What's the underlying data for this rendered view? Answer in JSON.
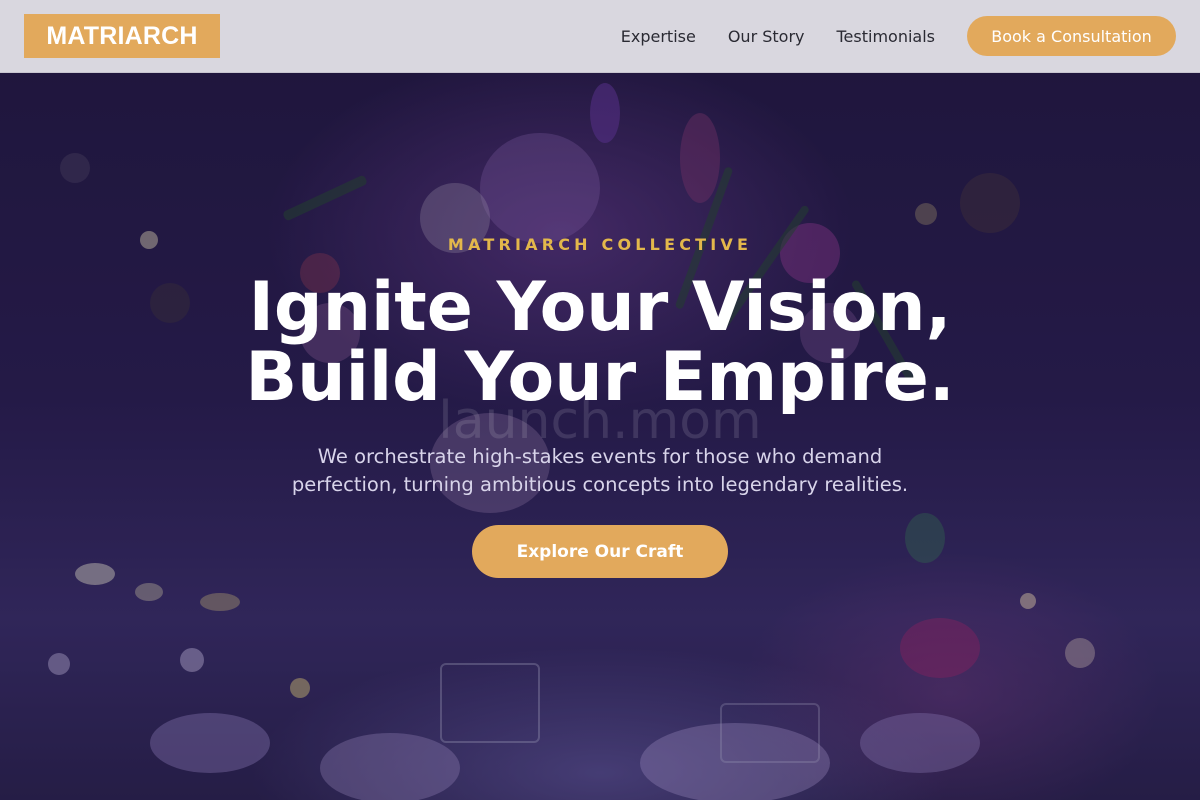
{
  "header": {
    "logo": "MATRIARCH",
    "nav": [
      {
        "label": "Expertise"
      },
      {
        "label": "Our Story"
      },
      {
        "label": "Testimonials"
      }
    ],
    "cta_label": "Book a Consultation"
  },
  "hero": {
    "eyebrow": "MATRIARCH COLLECTIVE",
    "headline_line1": "Ignite Your Vision,",
    "headline_line2": "Build Your Empire.",
    "subtitle": "We orchestrate high-stakes events for those who demand perfection, turning ambitious concepts into legendary realities.",
    "cta_label": "Explore Our Craft",
    "watermark": "launch.mom"
  },
  "colors": {
    "accent": "#e2a95c",
    "eyebrow": "#e3b84b",
    "header_bg": "#d9d7df",
    "hero_bg": "#2a1f52"
  }
}
